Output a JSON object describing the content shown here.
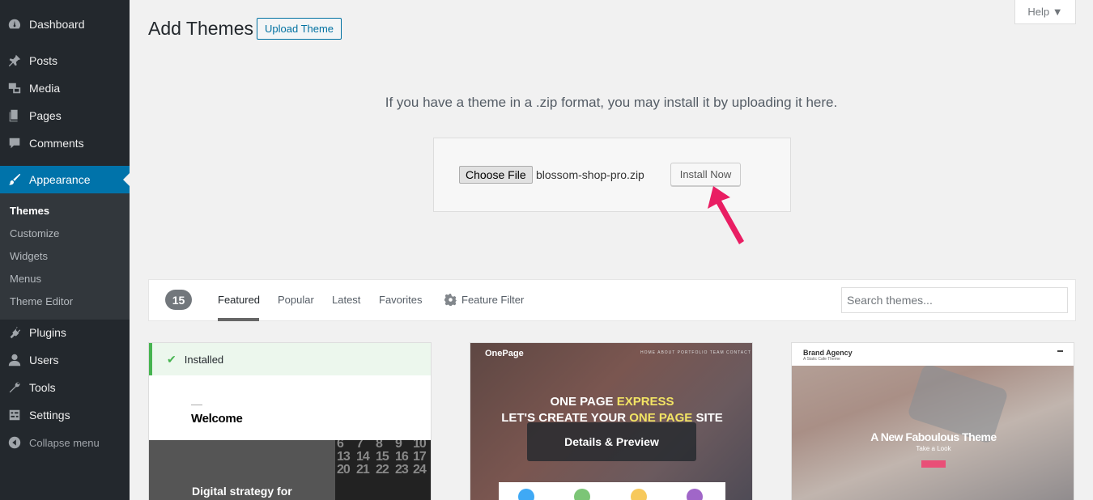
{
  "sidebar": {
    "items": [
      {
        "label": "Dashboard",
        "icon": "dashboard-icon"
      },
      {
        "label": "Posts",
        "icon": "pushpin-icon"
      },
      {
        "label": "Media",
        "icon": "media-icon"
      },
      {
        "label": "Pages",
        "icon": "pages-icon"
      },
      {
        "label": "Comments",
        "icon": "comment-icon"
      },
      {
        "label": "Appearance",
        "icon": "paintbrush-icon",
        "active": true
      },
      {
        "label": "Plugins",
        "icon": "plug-icon"
      },
      {
        "label": "Users",
        "icon": "user-icon"
      },
      {
        "label": "Tools",
        "icon": "wrench-icon"
      },
      {
        "label": "Settings",
        "icon": "settings-icon"
      }
    ],
    "submenu": [
      "Themes",
      "Customize",
      "Widgets",
      "Menus",
      "Theme Editor"
    ],
    "collapse_label": "Collapse menu"
  },
  "header": {
    "title": "Add Themes",
    "upload_button": "Upload Theme",
    "help": "Help ▼"
  },
  "upload": {
    "intro": "If you have a theme in a .zip format, you may install it by uploading it here.",
    "choose_file": "Choose File",
    "file_name": "blossom-shop-pro.zip",
    "install_now": "Install Now"
  },
  "filter": {
    "count": "15",
    "tabs": [
      "Featured",
      "Popular",
      "Latest",
      "Favorites"
    ],
    "feature_filter": "Feature Filter",
    "search_placeholder": "Search themes..."
  },
  "themes": {
    "card1": {
      "installed": "Installed",
      "welcome": "Welcome",
      "dark_text": "Digital strategy for",
      "calendar": [
        "6",
        "7",
        "8",
        "9",
        "10",
        "13",
        "14",
        "15",
        "16",
        "17",
        "20",
        "21",
        "22",
        "23",
        "24"
      ]
    },
    "card2": {
      "logo": "OnePage",
      "nav": "HOME   ABOUT   PORTFOLIO   TEAM   CONTACT",
      "title_line1_a": "ONE PAGE ",
      "title_line1_b": "EXPRESS",
      "title_line2_a": "LET'S CREATE YOUR ",
      "title_line2_b": "ONE PAGE",
      "title_line2_c": " SITE",
      "overlay": "Details & Preview"
    },
    "card3": {
      "brand": "Brand Agency",
      "tagline": "A Static Cafe Theme",
      "heading": "A New Faboulous Theme",
      "sub": "Take a Look"
    }
  },
  "colors": {
    "sidebar_bg": "#23282d",
    "active_bg": "#0073aa",
    "accent_arrow": "#e91e63",
    "installed_green": "#46b450",
    "highlight_yellow": "#f2e464"
  }
}
